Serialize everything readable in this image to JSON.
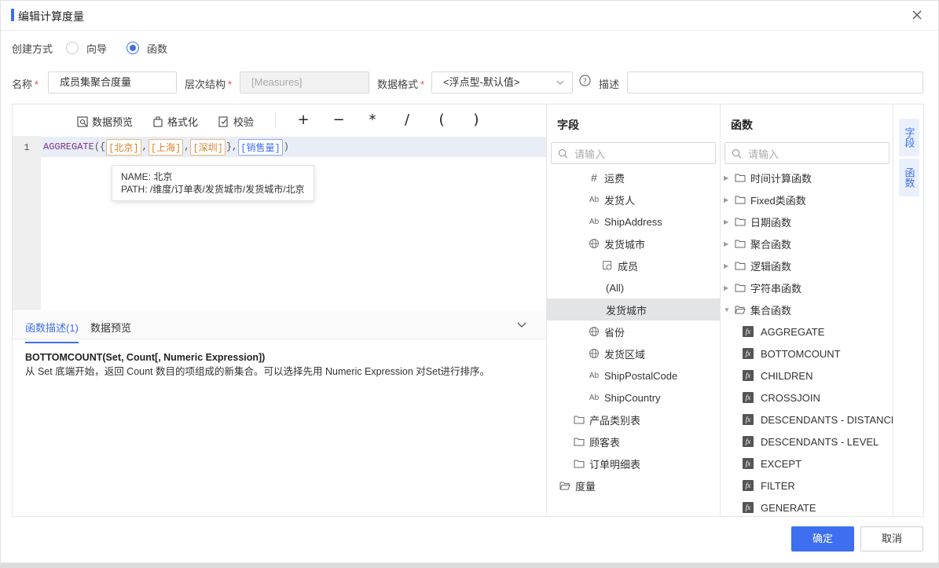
{
  "dialog": {
    "title": "编辑计算度量"
  },
  "create_mode": {
    "label": "创建方式",
    "options": [
      "向导",
      "函数"
    ],
    "selected": "函数"
  },
  "form": {
    "name_label": "名称",
    "name_value": "成员集聚合度量",
    "hierarchy_label": "层次结构",
    "hierarchy_value": "[Measures]",
    "format_label": "数据格式",
    "format_value": "<浮点型-默认值>",
    "desc_label": "描述",
    "desc_value": "",
    "required_mark": "*"
  },
  "toolbar": {
    "preview": "数据预览",
    "format": "格式化",
    "validate": "校验",
    "ops": [
      "+",
      "−",
      "*",
      "/",
      "(",
      ")"
    ]
  },
  "editor": {
    "line_number": "1",
    "fn": "AGGREGATE",
    "open": "({",
    "tokens": [
      "[北京]",
      "[上海]",
      "[深圳]"
    ],
    "sep": ",",
    "mid": "},",
    "measure_token": "[销售量]",
    "close": ")"
  },
  "tooltip": {
    "name": "NAME: 北京",
    "path": "PATH: /维度/订单表/发货城市/发货城市/北京"
  },
  "desc_tabs": {
    "tab1": "函数描述(1)",
    "tab2": "数据预览"
  },
  "description": {
    "signature": "BOTTOMCOUNT(Set, Count[, Numeric Expression])",
    "text": "从 Set 底端开始，返回 Count 数目的项组成的新集合。可以选择先用 Numeric Expression 对Set进行排序。"
  },
  "fields": {
    "title": "字段",
    "search_placeholder": "请输入",
    "items": [
      {
        "label": "运费",
        "icon": "number-icon"
      },
      {
        "label": "发货人",
        "icon": "text-icon"
      },
      {
        "label": "ShipAddress",
        "icon": "text-icon"
      },
      {
        "label": "发货城市",
        "icon": "globe-icon"
      },
      {
        "label": "成员",
        "icon": "member-icon"
      },
      {
        "label": "(All)",
        "icon": ""
      },
      {
        "label": "发货城市",
        "icon": ""
      },
      {
        "label": "省份",
        "icon": "globe-icon"
      },
      {
        "label": "发货区域",
        "icon": "globe-icon"
      },
      {
        "label": "ShipPostalCode",
        "icon": "text-icon"
      },
      {
        "label": "ShipCountry",
        "icon": "text-icon"
      },
      {
        "label": "产品类别表",
        "icon": "folder-icon"
      },
      {
        "label": "顾客表",
        "icon": "folder-icon"
      },
      {
        "label": "订单明细表",
        "icon": "folder-icon"
      },
      {
        "label": "度量",
        "icon": "folder-open-icon"
      }
    ]
  },
  "functions": {
    "title": "函数",
    "search_placeholder": "请输入",
    "groups": [
      "时间计算函数",
      "Fixed类函数",
      "日期函数",
      "聚合函数",
      "逻辑函数",
      "字符串函数",
      "集合函数"
    ],
    "items": [
      "AGGREGATE",
      "BOTTOMCOUNT",
      "CHILDREN",
      "CROSSJOIN",
      "DESCENDANTS - DISTANCE",
      "DESCENDANTS - LEVEL",
      "EXCEPT",
      "FILTER",
      "GENERATE"
    ]
  },
  "side_tabs": {
    "fields": "字段",
    "functions": "函数"
  },
  "buttons": {
    "ok": "确定",
    "cancel": "取消"
  },
  "colors": {
    "accent": "#3d6ff0",
    "member_token": "#d9822b",
    "required": "#e54a4a"
  }
}
